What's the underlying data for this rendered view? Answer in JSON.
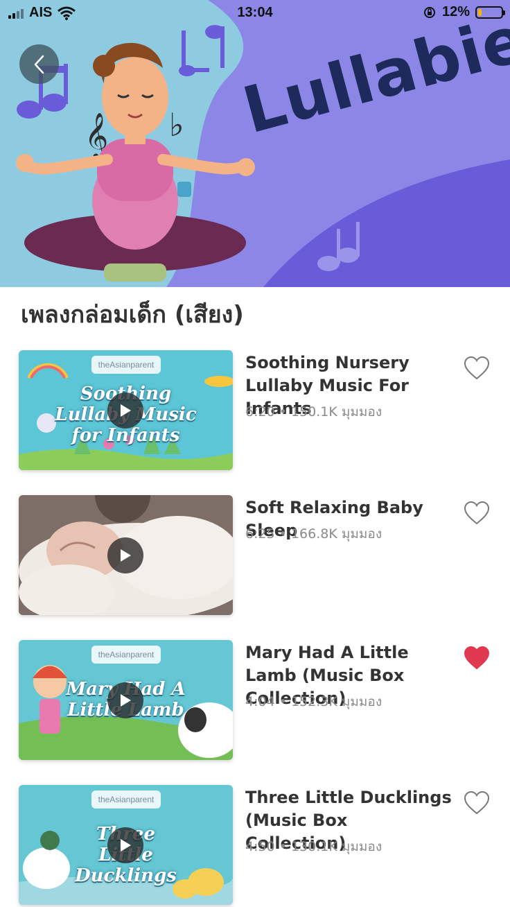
{
  "status_bar": {
    "carrier": "AIS",
    "time": "13:04",
    "battery": "12%",
    "icons": [
      "signal-icon",
      "wifi-icon",
      "orientation-lock-icon",
      "battery-icon"
    ]
  },
  "hero": {
    "title": "Lullabies",
    "back_icon": "chevron-left-icon"
  },
  "section_title": "เพลงกล่อมเด็ก (เสียง)",
  "colors": {
    "hero_sky": "#8fcbe0",
    "hero_purple": "#8c87e6",
    "hero_dark_purple": "#6a5cd8",
    "title_navy": "#1f2a5c",
    "heart_red": "#e0394f",
    "thumb_teal": "#5cc6d6"
  },
  "tracks": [
    {
      "title": "Soothing Nursery Lullaby Music For Infants",
      "meta": "6:20 • 150.1K มุมมอง",
      "favorite": false,
      "brand": "theAsianparent",
      "thumb_text": "Soothing Lullaby Music for Infants"
    },
    {
      "title": "Soft Relaxing Baby Sleep",
      "meta": "6:25 • 166.8K มุมมอง",
      "favorite": false,
      "brand": "",
      "thumb_text": ""
    },
    {
      "title": "Mary Had A Little Lamb (Music Box Collection)",
      "meta": "4:04 • 152.3K มุมมอง",
      "favorite": true,
      "brand": "theAsianparent",
      "thumb_text": "Mary Had A Little Lamb"
    },
    {
      "title": "Three Little Ducklings (Music Box Collection)",
      "meta": "4:50 • 130.1K มุมมอง",
      "favorite": false,
      "brand": "theAsianparent",
      "thumb_text": "Three Little Ducklings"
    }
  ]
}
